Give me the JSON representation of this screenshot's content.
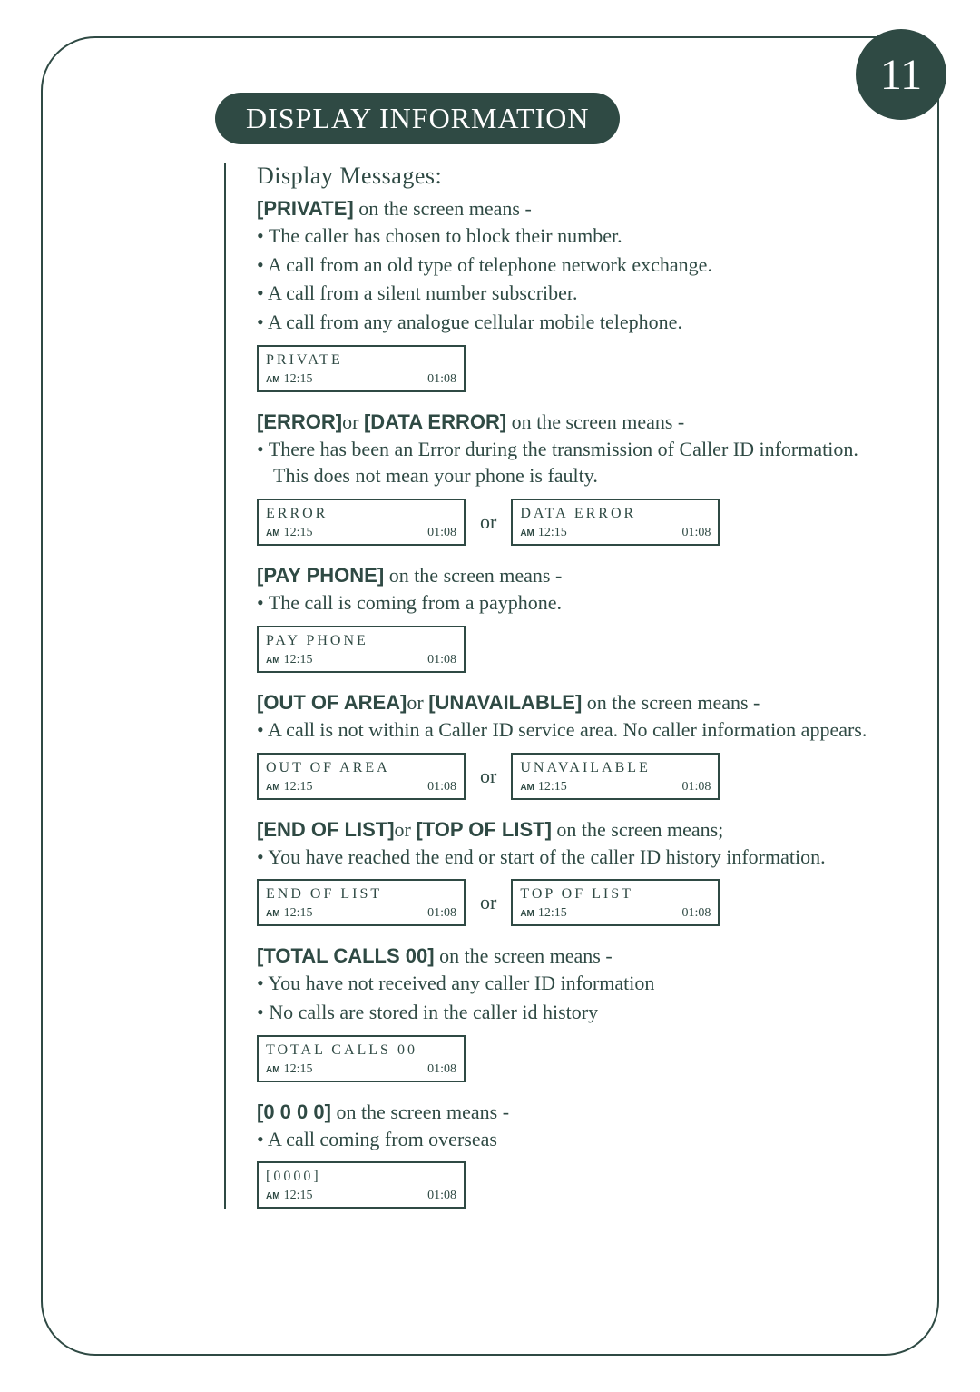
{
  "pageNumber": "11",
  "title": "DISPLAY INFORMATION",
  "sectionHeading": "Display Messages:",
  "suffix_means_dash": " on the screen means -",
  "suffix_means_semi": " on the screen means;",
  "or": "or",
  "lcd_common": {
    "am": "AM",
    "time": "12:15",
    "dur": "01:08"
  },
  "s1": {
    "tag": "[PRIVATE]",
    "bullets": [
      "The caller has chosen to block their number.",
      "A call from an old type of telephone network exchange.",
      "A call from a silent number subscriber.",
      "A call from any analogue cellular mobile telephone."
    ],
    "lcd": [
      {
        "label": "PRIVATE"
      }
    ]
  },
  "s2": {
    "tagA": "[ERROR]",
    "tagB": "[DATA ERROR]",
    "bullets": [
      "There has been an Error during the transmission of Caller ID information. This does not mean your phone is faulty."
    ],
    "lcd": [
      {
        "label": "ERROR"
      },
      {
        "label": "DATA ERROR"
      }
    ]
  },
  "s3": {
    "tag": "[PAY PHONE]",
    "bullets": [
      "The call is coming from a payphone."
    ],
    "lcd": [
      {
        "label": "PAY PHONE"
      }
    ]
  },
  "s4": {
    "tagA": "[OUT OF AREA]",
    "tagB": "[UNAVAILABLE]",
    "bullets": [
      "A call is not within a Caller ID service area. No caller information appears."
    ],
    "lcd": [
      {
        "label": "OUT OF AREA"
      },
      {
        "label": "UNAVAILABLE"
      }
    ]
  },
  "s5": {
    "tagA": "[END OF LIST]",
    "tagB": "[TOP OF LIST]",
    "bullets": [
      "You have reached the end or start of the caller ID history information."
    ],
    "lcd": [
      {
        "label": "END OF LIST"
      },
      {
        "label": "TOP OF LIST"
      }
    ]
  },
  "s6": {
    "tag": "[TOTAL CALLS 00]",
    "bullets": [
      "You have not received any caller ID information",
      "No calls are stored in the caller id history"
    ],
    "lcd": [
      {
        "label": "TOTAL CALLS 00"
      }
    ]
  },
  "s7": {
    "tag": "[0 0 0 0]",
    "bullets": [
      "A call coming from overseas"
    ],
    "lcd": [
      {
        "label": "[0000]"
      }
    ]
  }
}
